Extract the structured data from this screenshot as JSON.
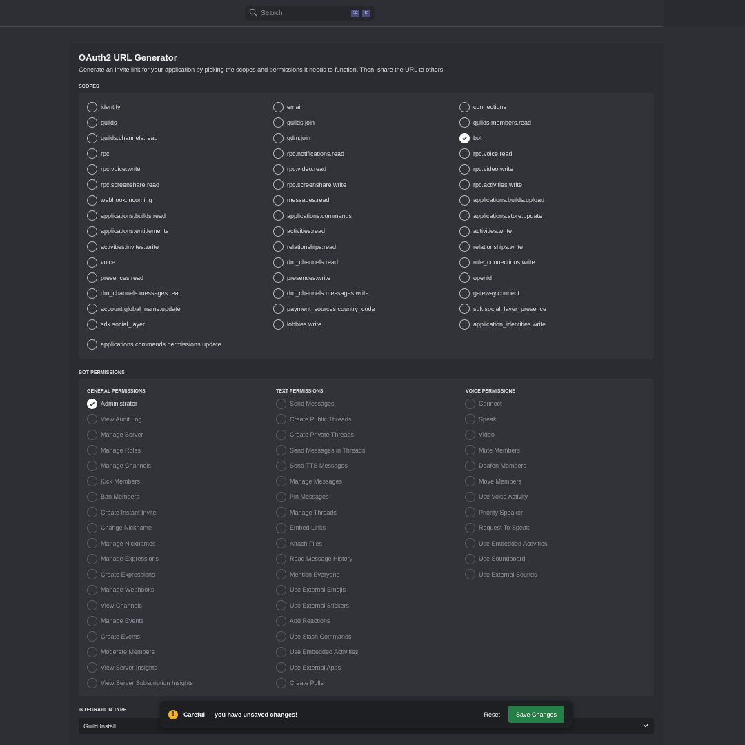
{
  "search": {
    "placeholder": "Search",
    "kbd": [
      "⌘",
      "K"
    ]
  },
  "header": {
    "title": "OAuth2 URL Generator",
    "subtitle": "Generate an invite link for your application by picking the scopes and permissions it needs to function. Then, share the URL to others!"
  },
  "scopes": {
    "label": "SCOPES",
    "items": [
      {
        "label": "identify",
        "checked": false
      },
      {
        "label": "email",
        "checked": false
      },
      {
        "label": "connections",
        "checked": false
      },
      {
        "label": "guilds",
        "checked": false
      },
      {
        "label": "guilds.join",
        "checked": false
      },
      {
        "label": "guilds.members.read",
        "checked": false
      },
      {
        "label": "guilds.channels.read",
        "checked": false
      },
      {
        "label": "gdm.join",
        "checked": false
      },
      {
        "label": "bot",
        "checked": true
      },
      {
        "label": "rpc",
        "checked": false
      },
      {
        "label": "rpc.notifications.read",
        "checked": false
      },
      {
        "label": "rpc.voice.read",
        "checked": false
      },
      {
        "label": "rpc.voice.write",
        "checked": false
      },
      {
        "label": "rpc.video.read",
        "checked": false
      },
      {
        "label": "rpc.video.write",
        "checked": false
      },
      {
        "label": "rpc.screenshare.read",
        "checked": false
      },
      {
        "label": "rpc.screenshare.write",
        "checked": false
      },
      {
        "label": "rpc.activities.write",
        "checked": false
      },
      {
        "label": "webhook.incoming",
        "checked": false
      },
      {
        "label": "messages.read",
        "checked": false
      },
      {
        "label": "applications.builds.upload",
        "checked": false
      },
      {
        "label": "applications.builds.read",
        "checked": false
      },
      {
        "label": "applications.commands",
        "checked": false
      },
      {
        "label": "applications.store.update",
        "checked": false
      },
      {
        "label": "applications.entitlements",
        "checked": false
      },
      {
        "label": "activities.read",
        "checked": false
      },
      {
        "label": "activities.write",
        "checked": false
      },
      {
        "label": "activities.invites.write",
        "checked": false
      },
      {
        "label": "relationships.read",
        "checked": false
      },
      {
        "label": "relationships.write",
        "checked": false
      },
      {
        "label": "voice",
        "checked": false
      },
      {
        "label": "dm_channels.read",
        "checked": false
      },
      {
        "label": "role_connections.write",
        "checked": false
      },
      {
        "label": "presences.read",
        "checked": false
      },
      {
        "label": "presences.write",
        "checked": false
      },
      {
        "label": "openid",
        "checked": false
      },
      {
        "label": "dm_channels.messages.read",
        "checked": false
      },
      {
        "label": "dm_channels.messages.write",
        "checked": false
      },
      {
        "label": "gateway.connect",
        "checked": false
      },
      {
        "label": "account.global_name.update",
        "checked": false
      },
      {
        "label": "payment_sources.country_code",
        "checked": false
      },
      {
        "label": "sdk.social_layer_presence",
        "checked": false
      },
      {
        "label": "sdk.social_layer",
        "checked": false
      },
      {
        "label": "lobbies.write",
        "checked": false
      },
      {
        "label": "application_identities.write",
        "checked": false
      },
      {
        "label": "applications.commands.permissions.update",
        "checked": false
      }
    ]
  },
  "bot_permissions": {
    "label": "BOT PERMISSIONS",
    "general": {
      "heading": "GENERAL PERMISSIONS",
      "items": [
        {
          "label": "Administrator",
          "checked": true,
          "disabled": false
        },
        {
          "label": "View Audit Log",
          "checked": false,
          "disabled": true
        },
        {
          "label": "Manage Server",
          "checked": false,
          "disabled": true
        },
        {
          "label": "Manage Roles",
          "checked": false,
          "disabled": true
        },
        {
          "label": "Manage Channels",
          "checked": false,
          "disabled": true
        },
        {
          "label": "Kick Members",
          "checked": false,
          "disabled": true
        },
        {
          "label": "Ban Members",
          "checked": false,
          "disabled": true
        },
        {
          "label": "Create Instant Invite",
          "checked": false,
          "disabled": true
        },
        {
          "label": "Change Nickname",
          "checked": false,
          "disabled": true
        },
        {
          "label": "Manage Nicknames",
          "checked": false,
          "disabled": true
        },
        {
          "label": "Manage Expressions",
          "checked": false,
          "disabled": true
        },
        {
          "label": "Create Expressions",
          "checked": false,
          "disabled": true
        },
        {
          "label": "Manage Webhooks",
          "checked": false,
          "disabled": true
        },
        {
          "label": "View Channels",
          "checked": false,
          "disabled": true
        },
        {
          "label": "Manage Events",
          "checked": false,
          "disabled": true
        },
        {
          "label": "Create Events",
          "checked": false,
          "disabled": true
        },
        {
          "label": "Moderate Members",
          "checked": false,
          "disabled": true
        },
        {
          "label": "View Server Insights",
          "checked": false,
          "disabled": true
        },
        {
          "label": "View Server Subscription Insights",
          "checked": false,
          "disabled": true
        }
      ]
    },
    "text": {
      "heading": "TEXT PERMISSIONS",
      "items": [
        {
          "label": "Send Messages",
          "checked": false,
          "disabled": true
        },
        {
          "label": "Create Public Threads",
          "checked": false,
          "disabled": true
        },
        {
          "label": "Create Private Threads",
          "checked": false,
          "disabled": true
        },
        {
          "label": "Send Messages in Threads",
          "checked": false,
          "disabled": true
        },
        {
          "label": "Send TTS Messages",
          "checked": false,
          "disabled": true
        },
        {
          "label": "Manage Messages",
          "checked": false,
          "disabled": true
        },
        {
          "label": "Pin Messages",
          "checked": false,
          "disabled": true
        },
        {
          "label": "Manage Threads",
          "checked": false,
          "disabled": true
        },
        {
          "label": "Embed Links",
          "checked": false,
          "disabled": true
        },
        {
          "label": "Attach Files",
          "checked": false,
          "disabled": true
        },
        {
          "label": "Read Message History",
          "checked": false,
          "disabled": true
        },
        {
          "label": "Mention Everyone",
          "checked": false,
          "disabled": true
        },
        {
          "label": "Use External Emojis",
          "checked": false,
          "disabled": true
        },
        {
          "label": "Use External Stickers",
          "checked": false,
          "disabled": true
        },
        {
          "label": "Add Reactions",
          "checked": false,
          "disabled": true
        },
        {
          "label": "Use Slash Commands",
          "checked": false,
          "disabled": true
        },
        {
          "label": "Use Embedded Activities",
          "checked": false,
          "disabled": true
        },
        {
          "label": "Use External Apps",
          "checked": false,
          "disabled": true
        },
        {
          "label": "Create Polls",
          "checked": false,
          "disabled": true
        }
      ]
    },
    "voice": {
      "heading": "VOICE PERMISSIONS",
      "items": [
        {
          "label": "Connect",
          "checked": false,
          "disabled": true
        },
        {
          "label": "Speak",
          "checked": false,
          "disabled": true
        },
        {
          "label": "Video",
          "checked": false,
          "disabled": true
        },
        {
          "label": "Mute Members",
          "checked": false,
          "disabled": true
        },
        {
          "label": "Deafen Members",
          "checked": false,
          "disabled": true
        },
        {
          "label": "Move Members",
          "checked": false,
          "disabled": true
        },
        {
          "label": "Use Voice Activity",
          "checked": false,
          "disabled": true
        },
        {
          "label": "Priority Speaker",
          "checked": false,
          "disabled": true
        },
        {
          "label": "Request To Speak",
          "checked": false,
          "disabled": true
        },
        {
          "label": "Use Embedded Activities",
          "checked": false,
          "disabled": true
        },
        {
          "label": "Use Soundboard",
          "checked": false,
          "disabled": true
        },
        {
          "label": "Use External Sounds",
          "checked": false,
          "disabled": true
        }
      ]
    }
  },
  "integration": {
    "label": "INTEGRATION TYPE",
    "value": "Guild Install"
  },
  "unsaved": {
    "message": "Careful — you have unsaved changes!",
    "warn_symbol": "!",
    "reset_label": "Reset",
    "save_label": "Save Changes"
  },
  "colors": {
    "save_button": "#248046",
    "warning": "#f0b232"
  }
}
